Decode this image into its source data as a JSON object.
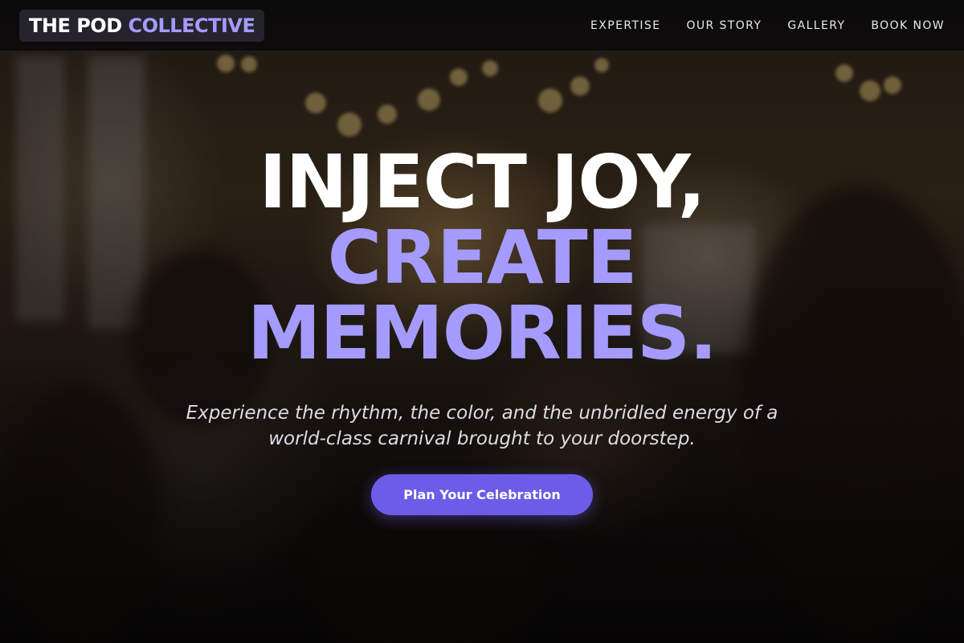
{
  "nav": {
    "logo_primary": "THE POD",
    "logo_accent": "COLLECTIVE",
    "links": [
      {
        "label": "EXPERTISE"
      },
      {
        "label": "OUR STORY"
      },
      {
        "label": "GALLERY"
      },
      {
        "label": "BOOK NOW"
      }
    ]
  },
  "hero": {
    "headline_line1": "INJECT JOY,",
    "headline_line2a": "CREATE",
    "headline_line2b": "MEMORIES.",
    "subtitle_line1": "Experience the rhythm, the color, and the unbridled energy of a",
    "subtitle_line2": "world-class carnival brought to your doorstep.",
    "cta_label": "Plan Your Celebration"
  },
  "colors": {
    "accent": "#a59bff",
    "button": "#6c5ce7",
    "nav_bg": "#08080a"
  }
}
